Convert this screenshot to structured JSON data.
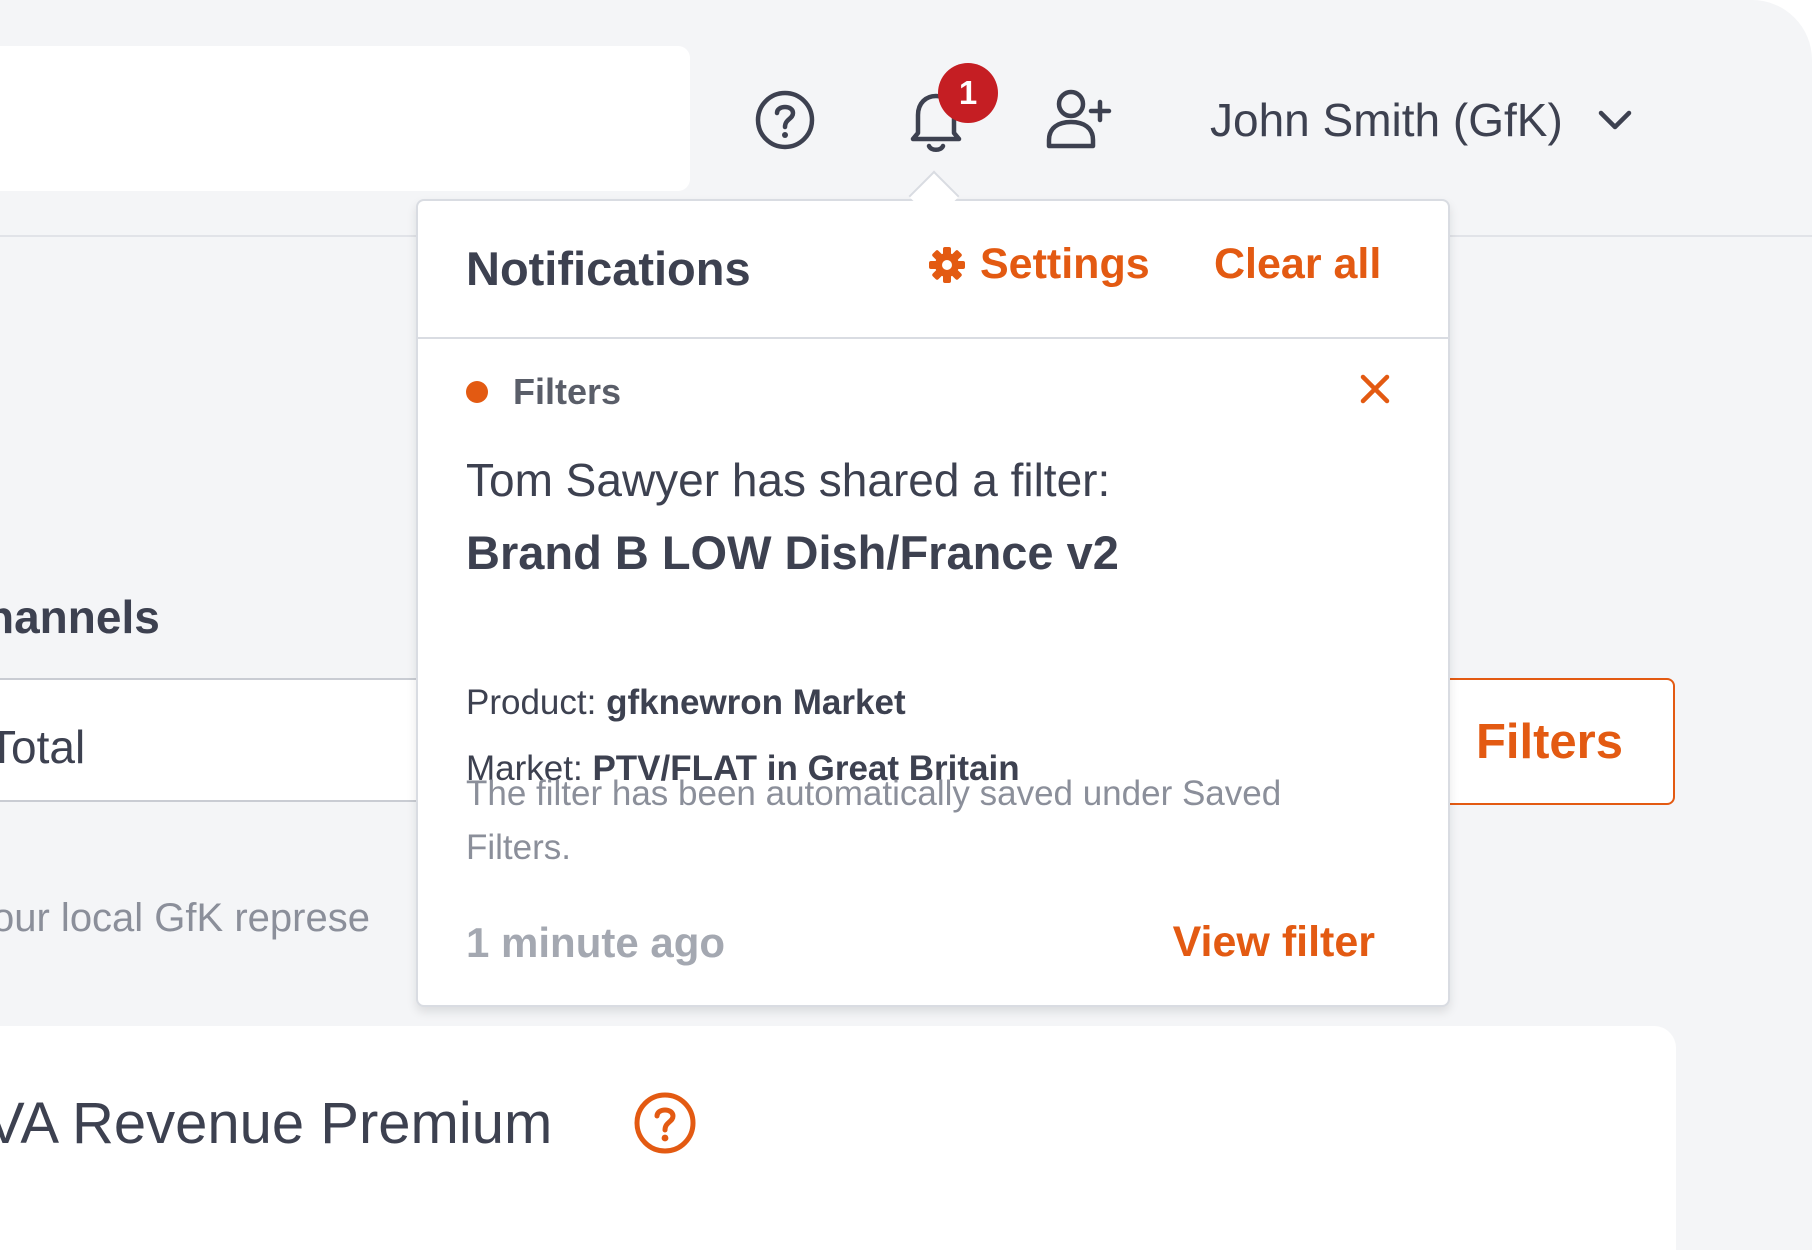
{
  "colors": {
    "accent": "#e35a12",
    "badge": "#c51e23",
    "text_primary": "#3d4150",
    "text_muted": "#8b8f9a",
    "background": "#f4f5f7"
  },
  "header": {
    "icons": {
      "help": "help-circle-icon",
      "notifications": "bell-icon",
      "invite": "add-user-icon",
      "user_menu": "chevron-down-icon"
    },
    "notification_count": "1",
    "user_name": "John Smith (GfK)"
  },
  "page": {
    "channels_label": "hannels",
    "channels_value": "Total",
    "filters_button": "Filters",
    "local_rep_text": "our local GfK represe",
    "revenue_title": "VA Revenue Premium",
    "revenue_help_icon": "help-circle-icon"
  },
  "notifications": {
    "title": "Notifications",
    "settings_label": "Settings",
    "settings_icon": "gear-icon",
    "clear_label": "Clear all",
    "item": {
      "category": "Filters",
      "dismiss_icon": "close-icon",
      "message": "Tom Sawyer has shared a filter:",
      "filter_name": "Brand B LOW Dish/France v2",
      "product_label": "Product:",
      "product_value": "gfknewron Market",
      "market_label": "Market:",
      "market_value": "PTV/FLAT in Great Britain",
      "note": "The filter has been automatically saved under Saved Filters.",
      "time": "1 minute ago",
      "action_label": "View filter"
    }
  }
}
